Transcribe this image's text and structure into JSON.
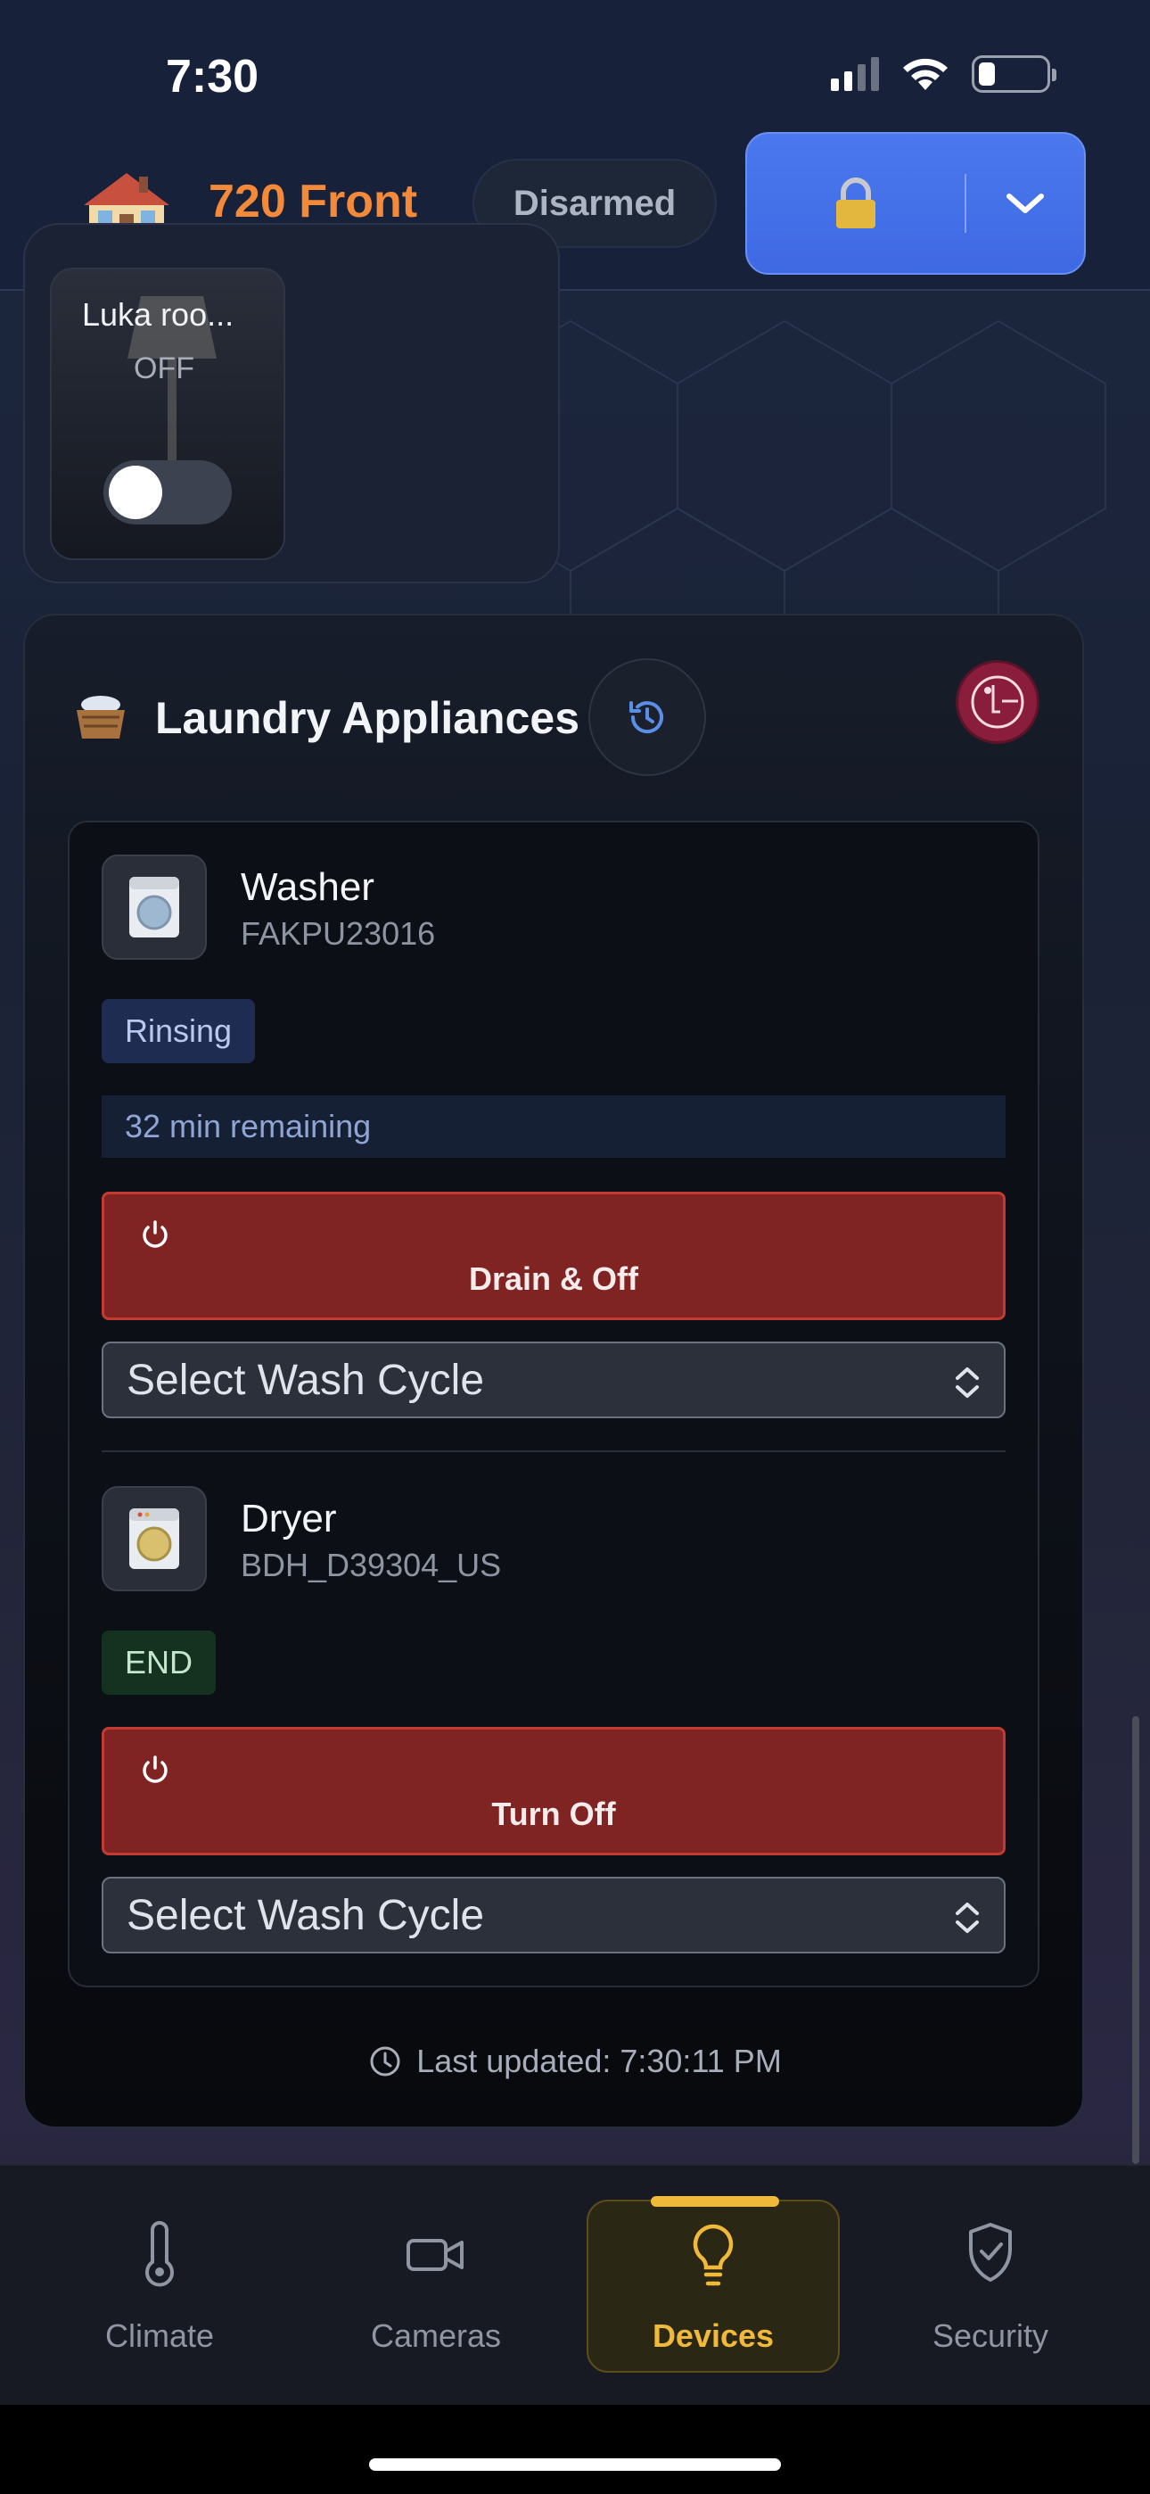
{
  "status_bar": {
    "time": "7:30"
  },
  "header": {
    "home_name": "720 Front",
    "mode": "Disarmed"
  },
  "light_tile": {
    "name": "Luka roo...",
    "state": "OFF",
    "toggle_on": false
  },
  "laundry": {
    "title": "Laundry Appliances",
    "brand_logo": "lg-logo",
    "washer": {
      "name": "Washer",
      "model": "FAKPU23016",
      "status": "Rinsing",
      "remaining": "32 min remaining",
      "action_label": "Drain & Off",
      "cycle_placeholder": "Select Wash Cycle"
    },
    "dryer": {
      "name": "Dryer",
      "model": "BDH_D39304_US",
      "status": "END",
      "action_label": "Turn Off",
      "cycle_placeholder": "Select Wash Cycle"
    },
    "last_updated": "Last updated: 7:30:11 PM"
  },
  "bottom_nav": {
    "items": [
      {
        "label": "Climate",
        "icon": "thermometer-icon"
      },
      {
        "label": "Cameras",
        "icon": "video-camera-icon"
      },
      {
        "label": "Devices",
        "icon": "lightbulb-icon",
        "active": true
      },
      {
        "label": "Security",
        "icon": "shield-check-icon"
      }
    ]
  },
  "colors": {
    "accent_orange": "#f28a3a",
    "lock_blue": "#4370e8",
    "danger_red": "#7f2323",
    "active_gold": "#f0b93a"
  }
}
